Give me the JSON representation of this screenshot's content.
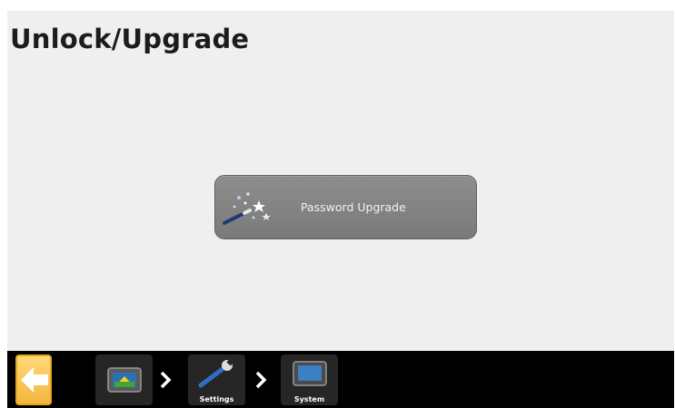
{
  "header": {
    "title": "Unlock/Upgrade"
  },
  "main": {
    "upgrade_button": {
      "label": "Password Upgrade",
      "icon": "magic-wand-icon"
    }
  },
  "bottom_bar": {
    "back_icon": "back-arrow-icon",
    "breadcrumbs": [
      {
        "label": "",
        "icon": "display-home-icon"
      },
      {
        "label": "Settings",
        "icon": "wrench-icon"
      },
      {
        "label": "System",
        "icon": "display-monitor-icon"
      }
    ],
    "separator_icon": "chevron-right-icon"
  },
  "colors": {
    "accent": "#f2b73f",
    "bar": "#000000",
    "button": "#848484",
    "background": "#efefef"
  }
}
